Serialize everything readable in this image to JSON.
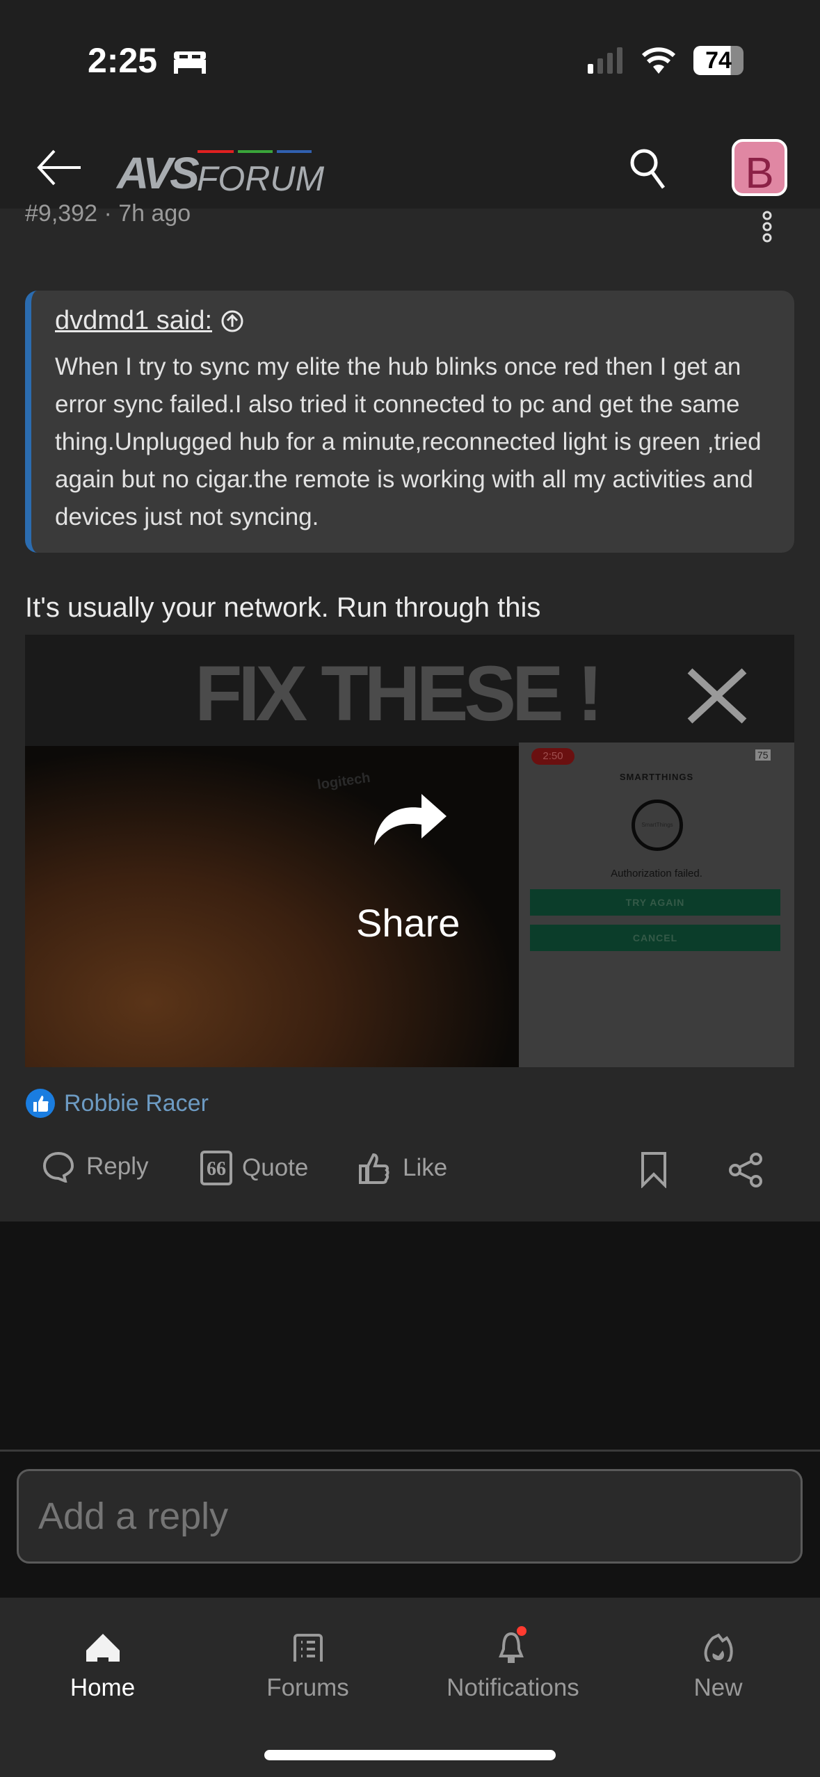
{
  "status_bar": {
    "time": "2:25",
    "battery": "74",
    "icons": [
      "bed-icon",
      "signal-icon",
      "wifi-icon",
      "battery-icon"
    ]
  },
  "header": {
    "logo": "AVSFORUM",
    "logo_colors": [
      "#e02020",
      "#3aa53a",
      "#3060b0"
    ],
    "avatar_letter": "B",
    "avatar_color": "#e087a3"
  },
  "post": {
    "meta": "#9,392 · 7h ago",
    "quote": {
      "author": "dvdmd1 said:",
      "text": "When I try to sync my elite the hub blinks once red then I get an error sync failed.I also tried it connected to pc and get the same thing.Unplugged hub for a minute,reconnected light is green ,tried again but no cigar.the remote is working with all my activities and devices just not syncing."
    },
    "text": "It's usually your network. Run through this",
    "video": {
      "title_overlay": "FIX THESE !",
      "share_label": "Share",
      "phone_time": "2:50",
      "phone_battery": "75",
      "app_title": "SMARTTHINGS",
      "logo_text": "SmartThings",
      "error": "Authorization failed.",
      "try_again": "TRY AGAIN",
      "cancel": "CANCEL",
      "brand": "logitech"
    },
    "liked_by": "Robbie Racer",
    "actions": {
      "reply": "Reply",
      "quote": "Quote",
      "like": "Like"
    }
  },
  "reply_input": {
    "placeholder": "Add a reply"
  },
  "bottom_nav": [
    {
      "label": "Home",
      "icon": "home-icon",
      "active": true
    },
    {
      "label": "Forums",
      "icon": "forums-icon"
    },
    {
      "label": "Notifications",
      "icon": "bell-icon",
      "badge": true
    },
    {
      "label": "New",
      "icon": "flame-icon"
    }
  ]
}
